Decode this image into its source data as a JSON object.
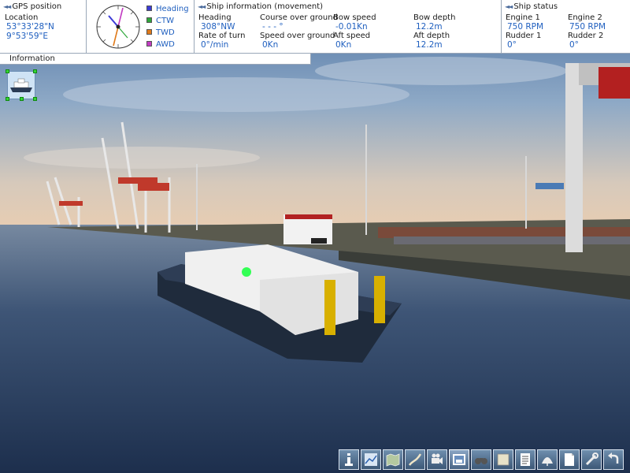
{
  "gps": {
    "title": "GPS position",
    "location_label": "Location",
    "lat": "53°33'28\"N",
    "lon": "9°53'59\"E"
  },
  "compass": {
    "legend": [
      {
        "label": "Heading",
        "color": "#3b3bd6"
      },
      {
        "label": "CTW",
        "color": "#2ea83a"
      },
      {
        "label": "TWD",
        "color": "#e07a1a"
      },
      {
        "label": "AWD",
        "color": "#c23bc2"
      }
    ]
  },
  "ship_info": {
    "title": "Ship information (movement)",
    "heading_label": "Heading",
    "heading_value": "308°NW",
    "cog_label": "Course over ground",
    "cog_value": "- - - °",
    "bow_speed_label": "Bow speed",
    "bow_speed_value": "-0.01Kn",
    "bow_depth_label": "Bow depth",
    "bow_depth_value": "12.2m",
    "rot_label": "Rate of turn",
    "rot_value": "0°/min",
    "sog_label": "Speed over ground",
    "sog_value": "0Kn",
    "aft_speed_label": "Aft speed",
    "aft_speed_value": "0Kn",
    "aft_depth_label": "Aft depth",
    "aft_depth_value": "12.2m"
  },
  "ship_status": {
    "title": "Ship status",
    "engine1_label": "Engine 1",
    "engine1_value": "750 RPM",
    "engine2_label": "Engine 2",
    "engine2_value": "750 RPM",
    "rudder1_label": "Rudder 1",
    "rudder1_value": "0°",
    "rudder2_label": "Rudder 2",
    "rudder2_value": "0°"
  },
  "info_tab": {
    "label": "Information"
  },
  "toolbar": {
    "buttons": [
      {
        "icon": "info-icon"
      },
      {
        "icon": "route-icon"
      },
      {
        "icon": "map-icon"
      },
      {
        "icon": "rope-icon"
      },
      {
        "icon": "camera-icon"
      },
      {
        "icon": "photo-icon"
      },
      {
        "icon": "binoculars-icon"
      },
      {
        "icon": "panel-icon"
      },
      {
        "icon": "checklist-icon"
      },
      {
        "icon": "weather-icon"
      },
      {
        "icon": "document-icon"
      },
      {
        "icon": "tools-icon"
      },
      {
        "icon": "exit-icon"
      }
    ]
  }
}
